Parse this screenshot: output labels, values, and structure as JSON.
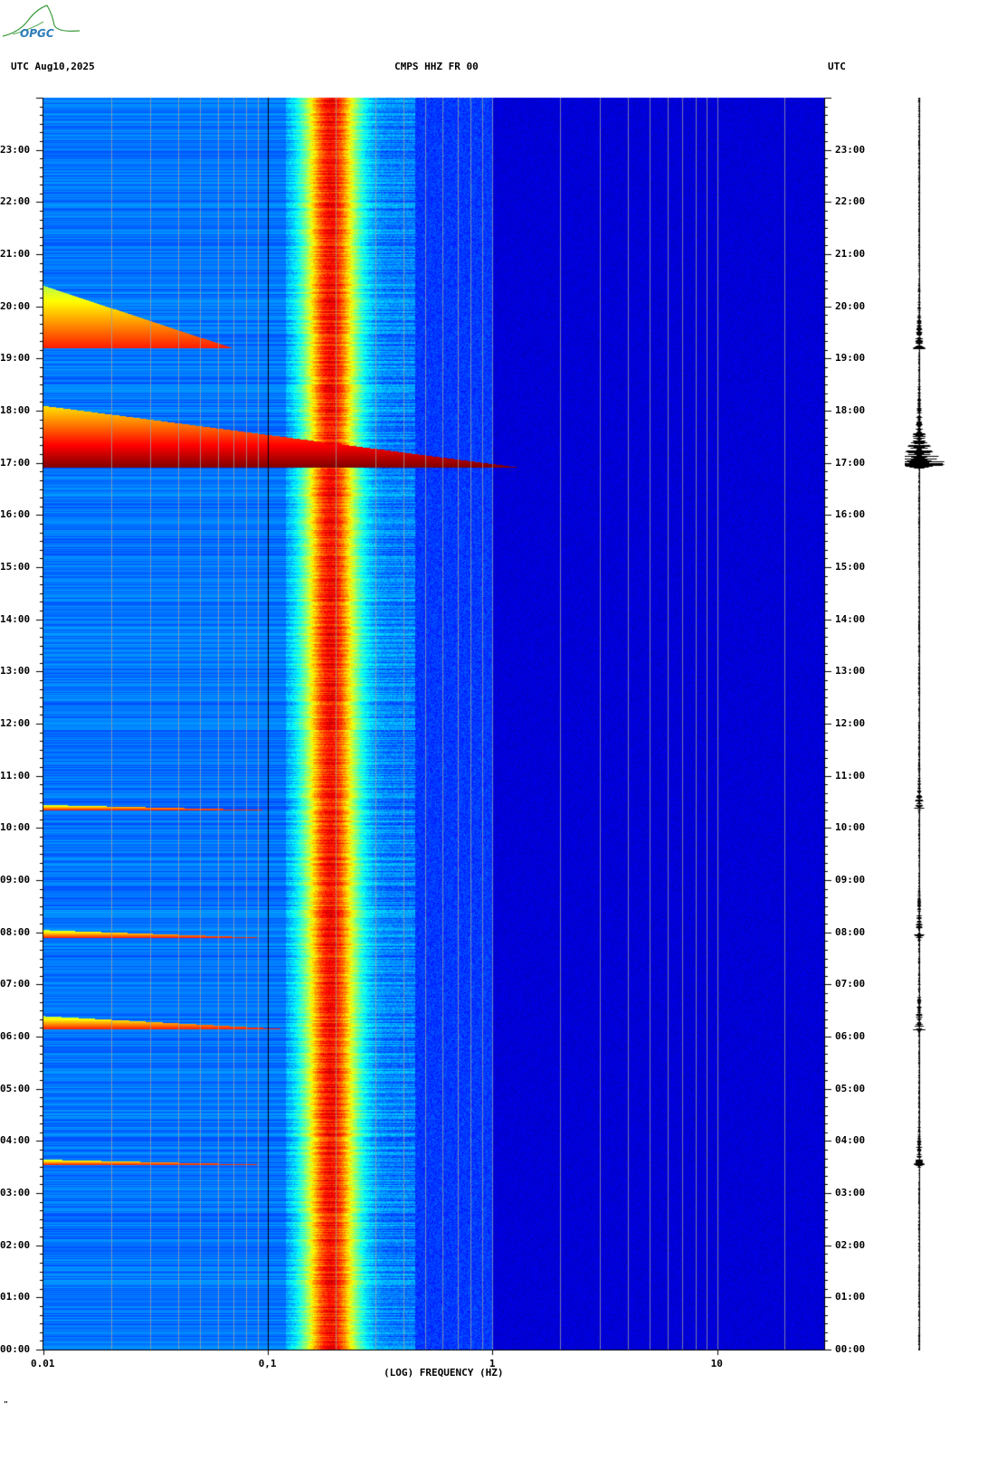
{
  "header": {
    "logo_text": "OPGC",
    "left_label": "UTC  Aug10,2025",
    "center_label": "CMPS HHZ FR 00",
    "right_label": "UTC"
  },
  "footer": {
    "xlabel": "(LOG) FREQUENCY (HZ)",
    "corner_mark": "\""
  },
  "colors": {
    "background": "#ffffff",
    "cmap": [
      "#000080",
      "#0000ff",
      "#0080ff",
      "#00ffff",
      "#80ff80",
      "#ffff00",
      "#ff8000",
      "#ff0000",
      "#800000"
    ]
  },
  "chart_data": {
    "type": "heatmap",
    "title": "CMPS HHZ FR 00",
    "xlabel": "(LOG) FREQUENCY (HZ)",
    "ylabel": "UTC",
    "x_scale": "log",
    "xlim": [
      0.01,
      30
    ],
    "x_ticks": [
      {
        "value": 0.01,
        "label": "0.01"
      },
      {
        "value": 0.1,
        "label": "0,1"
      },
      {
        "value": 1,
        "label": "1"
      },
      {
        "value": 10,
        "label": "10"
      }
    ],
    "ylim_hours": [
      0,
      24
    ],
    "y_ticks": [
      "00:00",
      "01:00",
      "02:00",
      "03:00",
      "04:00",
      "05:00",
      "06:00",
      "07:00",
      "08:00",
      "09:00",
      "10:00",
      "11:00",
      "12:00",
      "13:00",
      "14:00",
      "15:00",
      "16:00",
      "17:00",
      "18:00",
      "19:00",
      "20:00",
      "21:00",
      "22:00",
      "23:00"
    ],
    "grid": true,
    "microseism_band_hz": [
      0.12,
      0.45
    ],
    "microseism_peak_hz": [
      0.15,
      0.3
    ],
    "events": [
      {
        "time_h": 16.92,
        "end_h": 18.1,
        "fmax_hz": 1.3,
        "description": "large earthquake"
      },
      {
        "time_h": 6.15,
        "end_h": 6.4,
        "fmax_hz": 0.12
      },
      {
        "time_h": 7.9,
        "end_h": 8.05,
        "fmax_hz": 0.1
      },
      {
        "time_h": 10.35,
        "end_h": 10.45,
        "fmax_hz": 0.1
      },
      {
        "time_h": 3.55,
        "end_h": 3.65,
        "fmax_hz": 0.1
      },
      {
        "time_h": 19.2,
        "end_h": 20.4,
        "fmax_hz": 0.07
      }
    ]
  }
}
